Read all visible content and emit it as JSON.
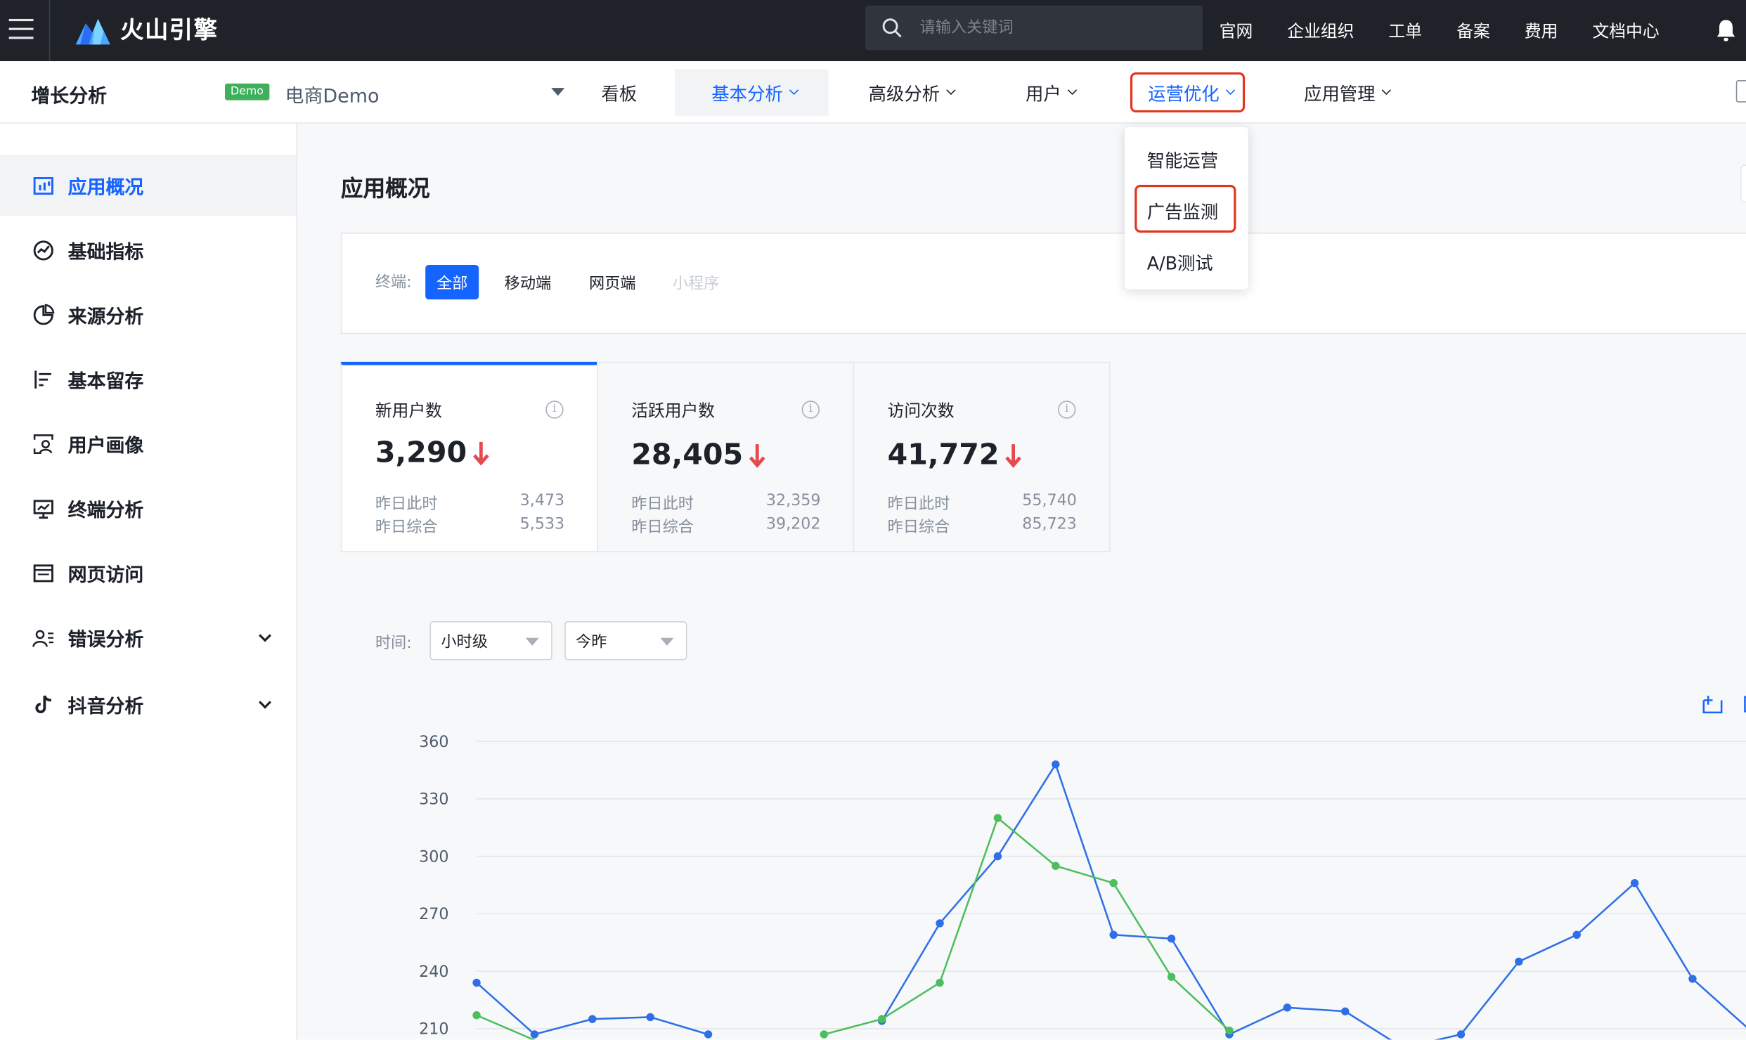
{
  "topbar": {
    "brand": "火山引擎",
    "search_placeholder": "请输入关键词",
    "links": [
      "官网",
      "企业组织",
      "工单",
      "备案",
      "费用",
      "文档中心"
    ]
  },
  "subnav": {
    "product": "增长分析",
    "demo_badge": "Demo",
    "app_name": "电商Demo",
    "items": [
      {
        "label": "看板"
      },
      {
        "label": "基本分析"
      },
      {
        "label": "高级分析"
      },
      {
        "label": "用户"
      },
      {
        "label": "运营优化"
      },
      {
        "label": "应用管理"
      }
    ]
  },
  "dropdown": {
    "options": [
      "智能运营",
      "广告监测",
      "A/B测试"
    ]
  },
  "sidebar": {
    "items": [
      {
        "label": "应用概况",
        "icon": "overview-icon"
      },
      {
        "label": "基础指标",
        "icon": "metrics-icon"
      },
      {
        "label": "来源分析",
        "icon": "pie-icon"
      },
      {
        "label": "基本留存",
        "icon": "retention-icon"
      },
      {
        "label": "用户画像",
        "icon": "portrait-icon"
      },
      {
        "label": "终端分析",
        "icon": "monitor-icon"
      },
      {
        "label": "网页访问",
        "icon": "browser-icon"
      },
      {
        "label": "错误分析",
        "icon": "users-icon"
      },
      {
        "label": "抖音分析",
        "icon": "douyin-icon"
      }
    ]
  },
  "main": {
    "title": "应用概况",
    "terminal_label": "终端:",
    "terminals": [
      "全部",
      "移动端",
      "网页端",
      "小程序"
    ],
    "metrics": [
      {
        "label": "新用户数",
        "value": "3,290",
        "yesterday_now_label": "昨日此时",
        "yesterday_now": "3,473",
        "yesterday_total_label": "昨日综合",
        "yesterday_total": "5,533"
      },
      {
        "label": "活跃用户数",
        "value": "28,405",
        "yesterday_now_label": "昨日此时",
        "yesterday_now": "32,359",
        "yesterday_total_label": "昨日综合",
        "yesterday_total": "39,202"
      },
      {
        "label": "访问次数",
        "value": "41,772",
        "yesterday_now_label": "昨日此时",
        "yesterday_now": "55,740",
        "yesterday_total_label": "昨日综合",
        "yesterday_total": "85,723"
      }
    ],
    "time_label": "时间:",
    "granularity": "小时级",
    "compare": "今昨"
  },
  "colors": {
    "accent": "#1664ff",
    "highlight": "#e0351e",
    "down_arrow": "#e5484d",
    "series_today": "#2f6fe6",
    "series_yesterday": "#4cbe5d"
  },
  "chart_data": {
    "type": "line",
    "y_ticks": [
      "360",
      "330",
      "300",
      "270",
      "240",
      "210"
    ],
    "ylim": [
      210,
      360
    ],
    "x": [
      0,
      1,
      2,
      3,
      4,
      5,
      6,
      7,
      8,
      9,
      10,
      11,
      12,
      13,
      14,
      15,
      16,
      17,
      18,
      19,
      20,
      21,
      22
    ],
    "series": [
      {
        "values": [
          234,
          207,
          215,
          216,
          207,
          null,
          null,
          214,
          265,
          300,
          348,
          259,
          257,
          207,
          221,
          219,
          200,
          207,
          245,
          259,
          286,
          236,
          209
        ]
      },
      {
        "values": [
          217,
          204,
          null,
          null,
          null,
          null,
          207,
          215,
          234,
          320,
          295,
          286,
          237,
          209,
          null,
          null,
          null,
          null,
          null,
          null,
          null,
          null,
          null
        ]
      }
    ]
  }
}
